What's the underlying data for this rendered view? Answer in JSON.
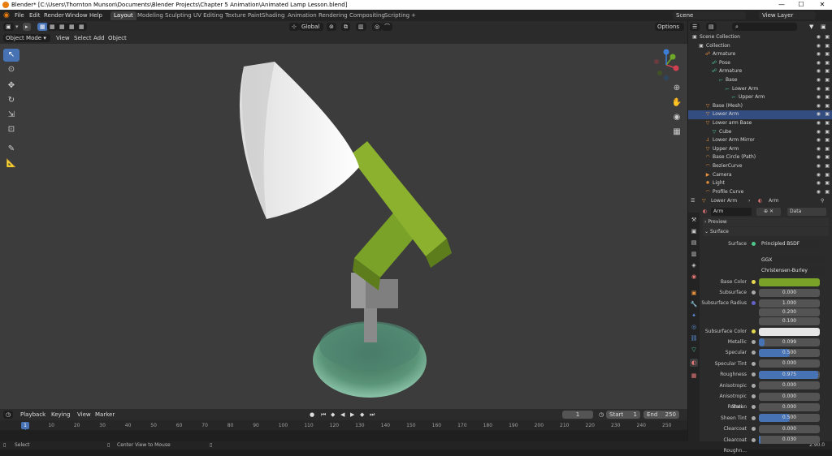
{
  "window": {
    "title": "Blender* [C:\\Users\\Thornton Munson\\Documents\\Blender Projects\\Chapter 5 Animation\\Animated Lamp Lesson.blend]",
    "minimize": "—",
    "maximize": "☐",
    "close": "✕"
  },
  "menu": [
    "File",
    "Edit",
    "Render",
    "Window",
    "Help"
  ],
  "workspaces": [
    "Layout",
    "Modeling",
    "Sculpting",
    "UV Editing",
    "Texture Paint",
    "Shading",
    "Animation",
    "Rendering",
    "Compositing",
    "Scripting"
  ],
  "workspace_add": "+",
  "scene": {
    "name": "Scene",
    "view_layer": "View Layer"
  },
  "viewport_header": {
    "mode": "Object Mode",
    "menus": [
      "View",
      "Select",
      "Add",
      "Object"
    ],
    "orientation": "Global",
    "options": "Options"
  },
  "timeline": {
    "menus": [
      "Playback",
      "Keying",
      "View",
      "Marker"
    ],
    "current_frame": "1",
    "start_label": "Start",
    "start": "1",
    "end_label": "End",
    "end": "250",
    "ticks": [
      "1",
      "10",
      "20",
      "30",
      "40",
      "50",
      "60",
      "70",
      "80",
      "90",
      "100",
      "110",
      "120",
      "130",
      "140",
      "150",
      "160",
      "170",
      "180",
      "190",
      "200",
      "210",
      "220",
      "230",
      "240",
      "250"
    ]
  },
  "status": {
    "left": "Select",
    "middle": "Center View to Mouse",
    "version": "2.90.0"
  },
  "outliner": {
    "search_placeholder": "",
    "rows": [
      {
        "label": "Scene Collection",
        "indent": 0,
        "icon": "scene-collection-icon",
        "glyph": "▣",
        "color": "#cfcfcf"
      },
      {
        "label": "Collection",
        "indent": 1,
        "icon": "collection-icon",
        "glyph": "▣",
        "color": "#cfcfcf"
      },
      {
        "label": "Armature",
        "indent": 2,
        "icon": "armature-icon",
        "glyph": "☍",
        "color": "#e6903c"
      },
      {
        "label": "Pose",
        "indent": 3,
        "icon": "pose-icon",
        "glyph": "☍",
        "color": "#4fc7a5"
      },
      {
        "label": "Armature",
        "indent": 3,
        "icon": "armature-data-icon",
        "glyph": "☍",
        "color": "#4fc7a5"
      },
      {
        "label": "Base",
        "indent": 4,
        "icon": "bone-icon",
        "glyph": "⤚",
        "color": "#4fc7a5"
      },
      {
        "label": "Lower Arm",
        "indent": 5,
        "icon": "bone-icon",
        "glyph": "⤚",
        "color": "#4fc7a5"
      },
      {
        "label": "Upper Arm",
        "indent": 6,
        "icon": "bone-icon",
        "glyph": "⤚",
        "color": "#4fc7a5"
      },
      {
        "label": "Base (Mesh)",
        "indent": 2,
        "icon": "mesh-object-icon",
        "glyph": "▽",
        "color": "#e6903c"
      },
      {
        "label": "Lower Arm",
        "indent": 2,
        "icon": "mesh-object-icon",
        "glyph": "▽",
        "color": "#e6903c",
        "selected": true
      },
      {
        "label": "Lower arm Base",
        "indent": 2,
        "icon": "mesh-object-icon",
        "glyph": "▽",
        "color": "#e6903c"
      },
      {
        "label": "Cube",
        "indent": 3,
        "icon": "mesh-data-icon",
        "glyph": "▽",
        "color": "#4fc7a5"
      },
      {
        "label": "Lower Arm Mirror",
        "indent": 2,
        "icon": "empty-icon",
        "glyph": "⅃",
        "color": "#e6903c"
      },
      {
        "label": "Upper Arm",
        "indent": 2,
        "icon": "mesh-object-icon",
        "glyph": "▽",
        "color": "#e6903c"
      },
      {
        "label": "Base Circle (Path)",
        "indent": 2,
        "icon": "curve-icon",
        "glyph": "◠",
        "color": "#e6903c"
      },
      {
        "label": "BezierCurve",
        "indent": 2,
        "icon": "curve-icon",
        "glyph": "◠",
        "color": "#e6903c"
      },
      {
        "label": "Camera",
        "indent": 2,
        "icon": "camera-icon",
        "glyph": "▶",
        "color": "#e6903c"
      },
      {
        "label": "Light",
        "indent": 2,
        "icon": "light-icon",
        "glyph": "✹",
        "color": "#e6903c"
      },
      {
        "label": "Profile Curve",
        "indent": 2,
        "icon": "curve-icon",
        "glyph": "◠",
        "color": "#e6903c"
      }
    ]
  },
  "properties": {
    "header_object": "Lower Arm",
    "header_material": "Arm",
    "material_name": "Arm",
    "data_label": "Data",
    "panel_preview": "Preview",
    "panel_surface": "Surface",
    "surface_label": "Surface",
    "surface_value": "Principled BSDF",
    "distribution": "GGX",
    "subsurface_method": "Christensen-Burley",
    "base_color_label": "Base Color",
    "base_color": "#7ba228",
    "subsurface_label": "Subsurface",
    "subsurface": "0.000",
    "subsurface_radius_label": "Subsurface Radius",
    "subsurface_radius": [
      "1.000",
      "0.200",
      "0.100"
    ],
    "subsurface_color_label": "Subsurface Color",
    "subsurface_color": "#e6e6e6",
    "rows": [
      {
        "label": "Metallic",
        "value": "0.099",
        "fill": 0.099
      },
      {
        "label": "Specular",
        "value": "0.500",
        "fill": 0.5
      },
      {
        "label": "Specular Tint",
        "value": "0.000",
        "fill": 0
      },
      {
        "label": "Roughness",
        "value": "0.975",
        "fill": 0.975
      },
      {
        "label": "Anisotropic",
        "value": "0.000",
        "fill": 0
      },
      {
        "label": "Anisotropic Rotati...",
        "value": "0.000",
        "fill": 0
      },
      {
        "label": "Sheen",
        "value": "0.000",
        "fill": 0
      },
      {
        "label": "Sheen Tint",
        "value": "0.500",
        "fill": 0.5
      },
      {
        "label": "Clearcoat",
        "value": "0.000",
        "fill": 0
      },
      {
        "label": "Clearcoat Roughn...",
        "value": "0.030",
        "fill": 0.03
      }
    ]
  },
  "colors": {
    "accent": "#4772b3",
    "selected_row": "#334d80",
    "arm_green": "#7ba228",
    "object_orange": "#e6903c",
    "data_teal": "#4fc7a5"
  }
}
